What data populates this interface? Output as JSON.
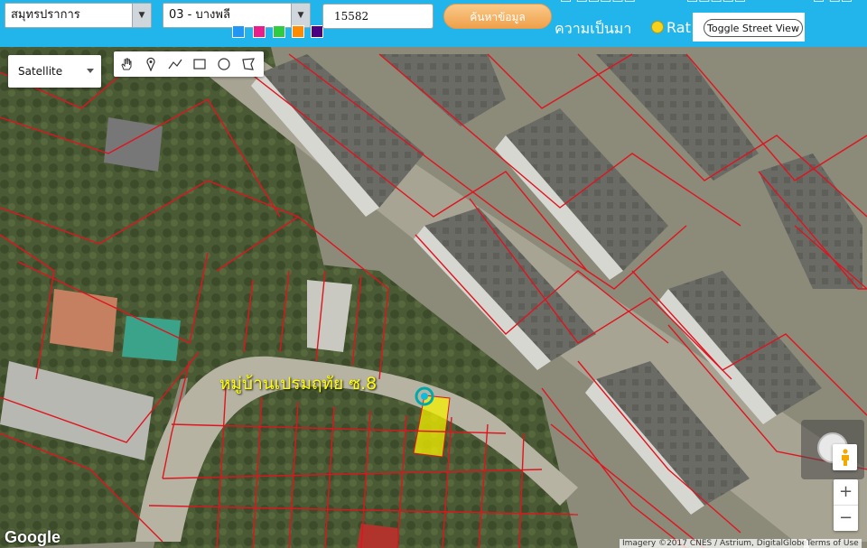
{
  "topbar": {
    "province_select": "สมุทรปราการ",
    "district_select": "03 - บางพลี",
    "parcel_input": "15582",
    "search_button": "ค้นหาข้อมูล",
    "history_link": "ความเป็นมา",
    "rate_link": "Rat",
    "toggle_street_view": "Toggle Street View",
    "swatch_colors": [
      "#2196f3",
      "#e91e8c",
      "#2ecc40",
      "#ff8c00",
      "#4b0082"
    ]
  },
  "map": {
    "map_type": "Satellite",
    "village_label": "หมู่บ้านเปรมฤทัย ซ.8",
    "highlight_color": "#f5f000",
    "boundary_color": "#e0141e",
    "google_logo": "Google",
    "attribution": "Imagery ©2017 CNES / Astrium, DigitalGlobe",
    "terms": "Terms of Use",
    "zoom_in": "+",
    "zoom_out": "−"
  },
  "icons": {
    "tools": [
      "hand-icon",
      "marker-icon",
      "polyline-icon",
      "rectangle-icon",
      "circle-icon",
      "polygon-icon"
    ]
  }
}
